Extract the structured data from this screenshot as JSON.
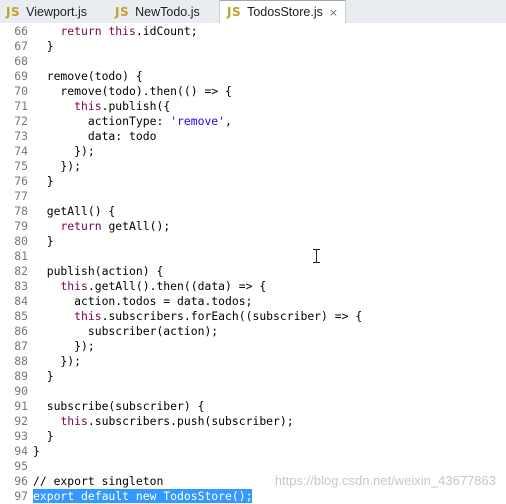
{
  "tabs": [
    {
      "label": "Viewport.js",
      "icon": "js-file-icon",
      "active": false
    },
    {
      "label": "NewTodo.js",
      "icon": "js-file-icon",
      "active": false
    },
    {
      "label": "TodosStore.js",
      "icon": "js-file-icon",
      "active": true
    }
  ],
  "js_badge": "JS",
  "close_glyph": "×",
  "lines": [
    {
      "n": "66",
      "text": "    return this.idCount;"
    },
    {
      "n": "67",
      "text": "  }"
    },
    {
      "n": "68",
      "text": ""
    },
    {
      "n": "69",
      "text": "  remove(todo) {"
    },
    {
      "n": "70",
      "text": "    remove(todo).then(() => {"
    },
    {
      "n": "71",
      "text": "      this.publish({"
    },
    {
      "n": "72",
      "text": "        actionType: 'remove',"
    },
    {
      "n": "73",
      "text": "        data: todo"
    },
    {
      "n": "74",
      "text": "      });"
    },
    {
      "n": "75",
      "text": "    });"
    },
    {
      "n": "76",
      "text": "  }"
    },
    {
      "n": "77",
      "text": ""
    },
    {
      "n": "78",
      "text": "  getAll() {"
    },
    {
      "n": "79",
      "text": "    return getAll();"
    },
    {
      "n": "80",
      "text": "  }"
    },
    {
      "n": "81",
      "text": ""
    },
    {
      "n": "82",
      "text": "  publish(action) {"
    },
    {
      "n": "83",
      "text": "    this.getAll().then((data) => {"
    },
    {
      "n": "84",
      "text": "      action.todos = data.todos;"
    },
    {
      "n": "85",
      "text": "      this.subscribers.forEach((subscriber) => {"
    },
    {
      "n": "86",
      "text": "        subscriber(action);"
    },
    {
      "n": "87",
      "text": "      });"
    },
    {
      "n": "88",
      "text": "    });"
    },
    {
      "n": "89",
      "text": "  }"
    },
    {
      "n": "90",
      "text": ""
    },
    {
      "n": "91",
      "text": "  subscribe(subscriber) {"
    },
    {
      "n": "92",
      "text": "    this.subscribers.push(subscriber);"
    },
    {
      "n": "93",
      "text": "  }"
    },
    {
      "n": "94",
      "text": "}"
    },
    {
      "n": "95",
      "text": ""
    },
    {
      "n": "96",
      "text": "// export singleton"
    },
    {
      "n": "97",
      "text": "export default new TodosStore();"
    }
  ],
  "selected_line": "97",
  "watermark": "https://blog.csdn.net/weixin_43677863",
  "colors": {
    "keyword": "#7f0055",
    "string": "#2a00ff",
    "selection": "#3399ff",
    "line_number": "#787878"
  }
}
